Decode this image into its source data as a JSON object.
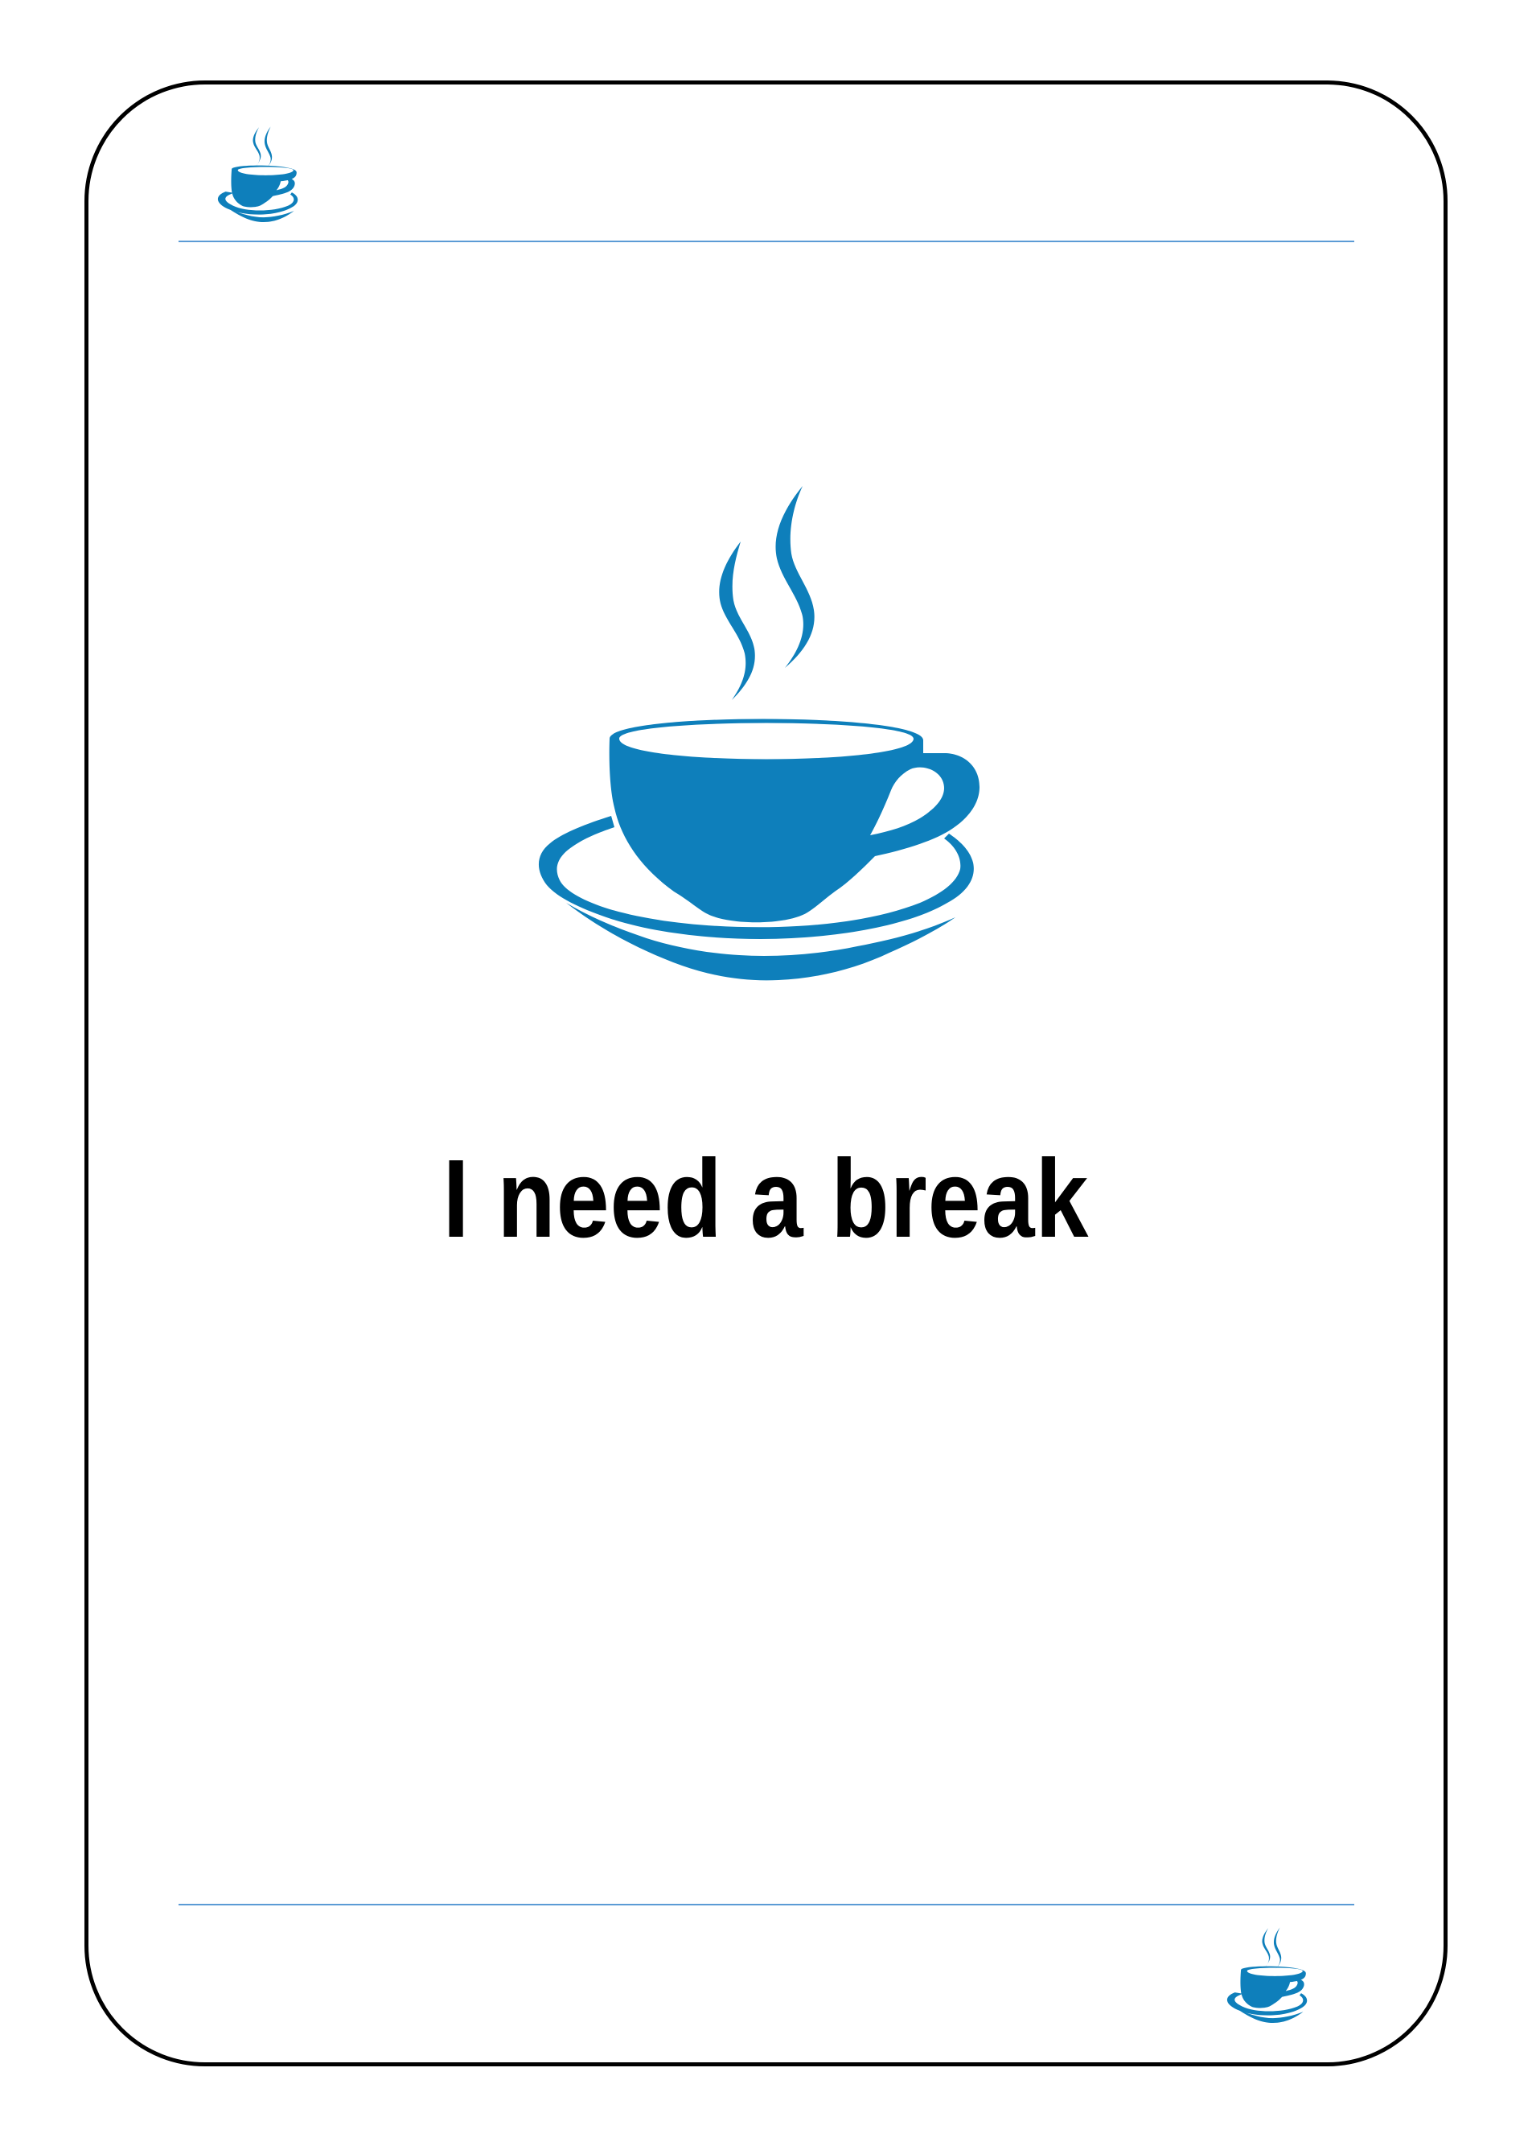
{
  "card": {
    "headline": "I need a break",
    "icon": "coffee-cup-icon"
  },
  "colors": {
    "accent": "#0e7fbb",
    "rule": "#5b9bd5",
    "border": "#000000",
    "text": "#000000"
  }
}
